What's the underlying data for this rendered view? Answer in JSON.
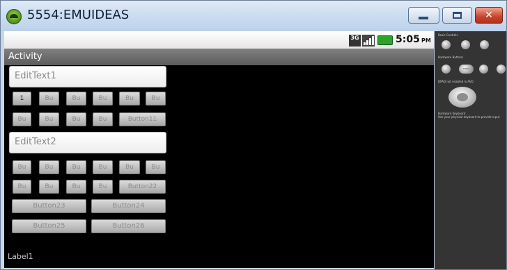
{
  "window": {
    "title": "5554:EMUIDEAS",
    "minimize_icon": "minimize-icon",
    "maximize_icon": "maximize-icon",
    "close_glyph": "✕"
  },
  "statusbar": {
    "network_label": "3G",
    "time": "5:05",
    "ampm": "PM"
  },
  "activity": {
    "title": "Activity",
    "edit1_value": "EditText1",
    "edit2_value": "EditText2",
    "group1": {
      "row1": [
        "1",
        "Bu",
        "Bu",
        "Bu",
        "Bu",
        "Bu"
      ],
      "row2": [
        "Bu",
        "Bu",
        "Bu",
        "Bu",
        "Button11"
      ]
    },
    "group2": {
      "row1": [
        "Bu",
        "Bu",
        "Bu",
        "Bu",
        "Bu",
        "Bu"
      ],
      "row2": [
        "Bu",
        "Bu",
        "Bu",
        "Bu",
        "Button22"
      ]
    },
    "wide_buttons": [
      "Button23",
      "Button24",
      "Button25",
      "Button26"
    ],
    "label": "Label1"
  },
  "controls_panel": {
    "basic_controls": "Basic Controls",
    "hardware_buttons": "Hardware Buttons",
    "menu_label": "MENU",
    "dpad_note": "DPAD not enabled in AVD",
    "hardware_keyboard": "Hardware Keyboard",
    "keyboard_note": "Use your physical keyboard to provide input"
  }
}
